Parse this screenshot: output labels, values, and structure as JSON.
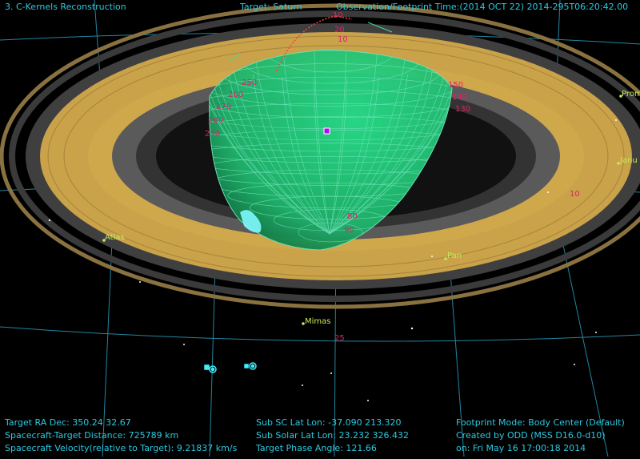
{
  "header": {
    "app_title": "3. C-Kernels Reconstruction",
    "target": "Target: Saturn",
    "obs_time": "Observation/Footprint Time:(2014 OCT 22) 2014-295T06:20:42.00"
  },
  "moons": {
    "atlas": "Atlas",
    "pan": "Pan",
    "mimas": "Mimas",
    "prom": "Prom",
    "janu": "Janu"
  },
  "grid_labels": {
    "lat": [
      "10",
      "20",
      "10"
    ],
    "lon_left": [
      "250",
      "260",
      "270",
      "280",
      "230"
    ],
    "lon_right": [
      "150",
      "140",
      "130"
    ],
    "south": [
      "80",
      "90"
    ],
    "misc": [
      "10",
      "25"
    ]
  },
  "info": {
    "ra_dec": "Target RA Dec: 350.24  32.67",
    "distance": "Spacecraft-Target Distance:  725789 km",
    "velocity": "Spacecraft Velocity(relative to Target): 9.21837 km/s",
    "sub_sc": "Sub SC Lat Lon: -37.090  213.320",
    "sub_solar": "Sub Solar Lat Lon: 23.232  326.432",
    "phase": "Target Phase Angle: 121.66",
    "footprint_mode": "Footprint Mode: Body Center (Default)",
    "created_by": "Created by ODD (MSS D16.0-d10)",
    "created_on": "on: Fri May 16 17:00:18 2014"
  },
  "colors": {
    "ring_gold": "#c9a24a",
    "ring_gap": "#404040",
    "planet_green": "#26d07c",
    "grid_cyan": "#2cc9e0",
    "label_magenta": "#e0206a",
    "moon_yellow": "#c8e85a"
  }
}
